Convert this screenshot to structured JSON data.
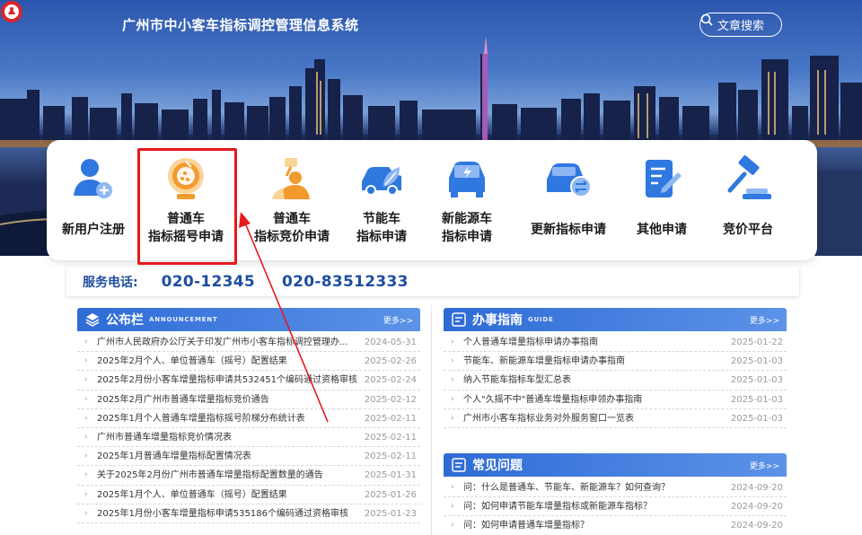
{
  "header": {
    "title": "广州市中小客车指标调控管理信息系统",
    "search_label": "文章搜索"
  },
  "nav": [
    {
      "icon": "new-user-icon",
      "label": "新用户注册"
    },
    {
      "icon": "lottery-ball-icon",
      "label": "普通车\n指标摇号申请"
    },
    {
      "icon": "bidding-person-icon",
      "label": "普通车\n指标竞价申请"
    },
    {
      "icon": "eco-car-icon",
      "label": "节能车\n指标申请"
    },
    {
      "icon": "electric-car-icon",
      "label": "新能源车\n指标申请"
    },
    {
      "icon": "renew-car-icon",
      "label": "更新指标申请"
    },
    {
      "icon": "edit-document-icon",
      "label": "其他申请"
    },
    {
      "icon": "auction-gavel-icon",
      "label": "竞价平台"
    }
  ],
  "service": {
    "label": "服务电话:",
    "phones": [
      "020-12345",
      "020-83512333"
    ]
  },
  "announcements": {
    "title": "公布栏",
    "subtitle": "ANNOUNCEMENT",
    "more": "更多>>",
    "items": [
      {
        "text": "广州市人民政府办公厅关于印发广州市小客车指标调控管理办...",
        "date": "2024-05-31"
      },
      {
        "text": "2025年2月个人、单位普通车（摇号）配置结果",
        "date": "2025-02-26"
      },
      {
        "text": "2025年2月份小客车增量指标申请共532451个编码通过资格审核",
        "date": "2025-02-24"
      },
      {
        "text": "2025年2月广州市普通车增量指标竞价通告",
        "date": "2025-02-12"
      },
      {
        "text": "2025年1月个人普通车增量指标摇号阶梯分布统计表",
        "date": "2025-02-11"
      },
      {
        "text": "广州市普通车增量指标竞价情况表",
        "date": "2025-02-11"
      },
      {
        "text": "2025年1月普通车增量指标配置情况表",
        "date": "2025-02-11"
      },
      {
        "text": "关于2025年2月份广州市普通车增量指标配置数量的通告",
        "date": "2025-01-31"
      },
      {
        "text": "2025年1月个人、单位普通车（摇号）配置结果",
        "date": "2025-01-26"
      },
      {
        "text": "2025年1月份小客车增量指标申请535186个编码通过资格审核",
        "date": "2025-01-23"
      }
    ]
  },
  "guide": {
    "title": "办事指南",
    "subtitle": "GUIDE",
    "more": "更多>>",
    "items": [
      {
        "text": "个人普通车增量指标申请办事指南",
        "date": "2025-01-22"
      },
      {
        "text": "节能车、新能源车增量指标申请办事指南",
        "date": "2025-01-03"
      },
      {
        "text": "纳入节能车指标车型汇总表",
        "date": "2025-01-03"
      },
      {
        "text": "个人\"久摇不中\"普通车增量指标申领办事指南",
        "date": "2025-01-03"
      },
      {
        "text": "广州市小客车指标业务对外服务窗口一览表",
        "date": "2025-01-03"
      }
    ]
  },
  "faq": {
    "title": "常见问题",
    "more": "更多>>",
    "items": [
      {
        "text": "问：什么是普通车、节能车、新能源车？如何查询？",
        "date": "2024-09-20"
      },
      {
        "text": "问：如何申请节能车增量指标或新能源车指标？",
        "date": "2024-09-20"
      },
      {
        "text": "问：如何申请普通车增量指标？",
        "date": "2024-09-20"
      }
    ]
  },
  "colors": {
    "brand_blue": "#1f4ea1",
    "header_blue": "#2f6bd6",
    "icon_blue": "#2f78e0",
    "icon_orange": "#f29a2e",
    "highlight_red": "#e6191e"
  }
}
